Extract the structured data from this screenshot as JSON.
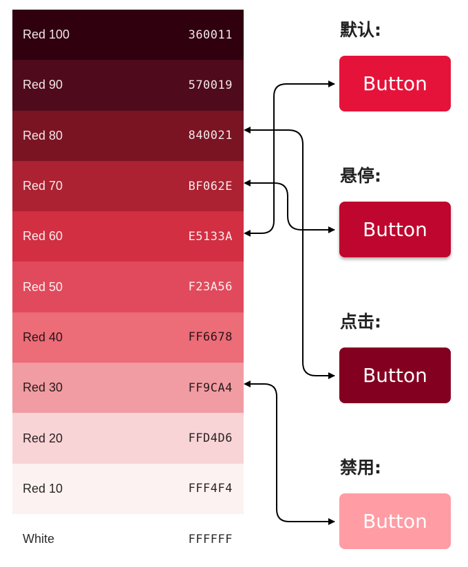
{
  "palette": [
    {
      "name": "Red 100",
      "hex": "360011",
      "bg": "#30000f",
      "fg": "#f2e6e8"
    },
    {
      "name": "Red 90",
      "hex": "570019",
      "bg": "#4f0b1b",
      "fg": "#f2e6e8"
    },
    {
      "name": "Red 80",
      "hex": "840021",
      "bg": "#7a1423",
      "fg": "#f2e6e8"
    },
    {
      "name": "Red 70",
      "hex": "BF062E",
      "bg": "#ac2232",
      "fg": "#f7eaec"
    },
    {
      "name": "Red 60",
      "hex": "E5133A",
      "bg": "#d22f42",
      "fg": "#fbeef0"
    },
    {
      "name": "Red 50",
      "hex": "F23A56",
      "bg": "#e14a5c",
      "fg": "#fdf0f2"
    },
    {
      "name": "Red 40",
      "hex": "FF6678",
      "bg": "#ec6c78",
      "fg": "#2a1416"
    },
    {
      "name": "Red 30",
      "hex": "FF9CA4",
      "bg": "#f09ca2",
      "fg": "#2a1a1b"
    },
    {
      "name": "Red 20",
      "hex": "FFD4D6",
      "bg": "#f8d4d7",
      "fg": "#2a2222"
    },
    {
      "name": "Red 10",
      "hex": "FFF4F4",
      "bg": "#fdf2f2",
      "fg": "#2a2626"
    },
    {
      "name": "White",
      "hex": "FFFFFF",
      "bg": "#ffffff",
      "fg": "#2a2a2a"
    }
  ],
  "states": [
    {
      "label": "默认:",
      "button_label": "Button",
      "bg": "#e5133a",
      "source_swatch": "Red 60"
    },
    {
      "label": "悬停:",
      "button_label": "Button",
      "bg": "#bf062e",
      "source_swatch": "Red 70"
    },
    {
      "label": "点击:",
      "button_label": "Button",
      "bg": "#840021",
      "source_swatch": "Red 80"
    },
    {
      "label": "禁用:",
      "button_label": "Button",
      "bg": "#ff9ca4",
      "source_swatch": "Red 30"
    }
  ]
}
